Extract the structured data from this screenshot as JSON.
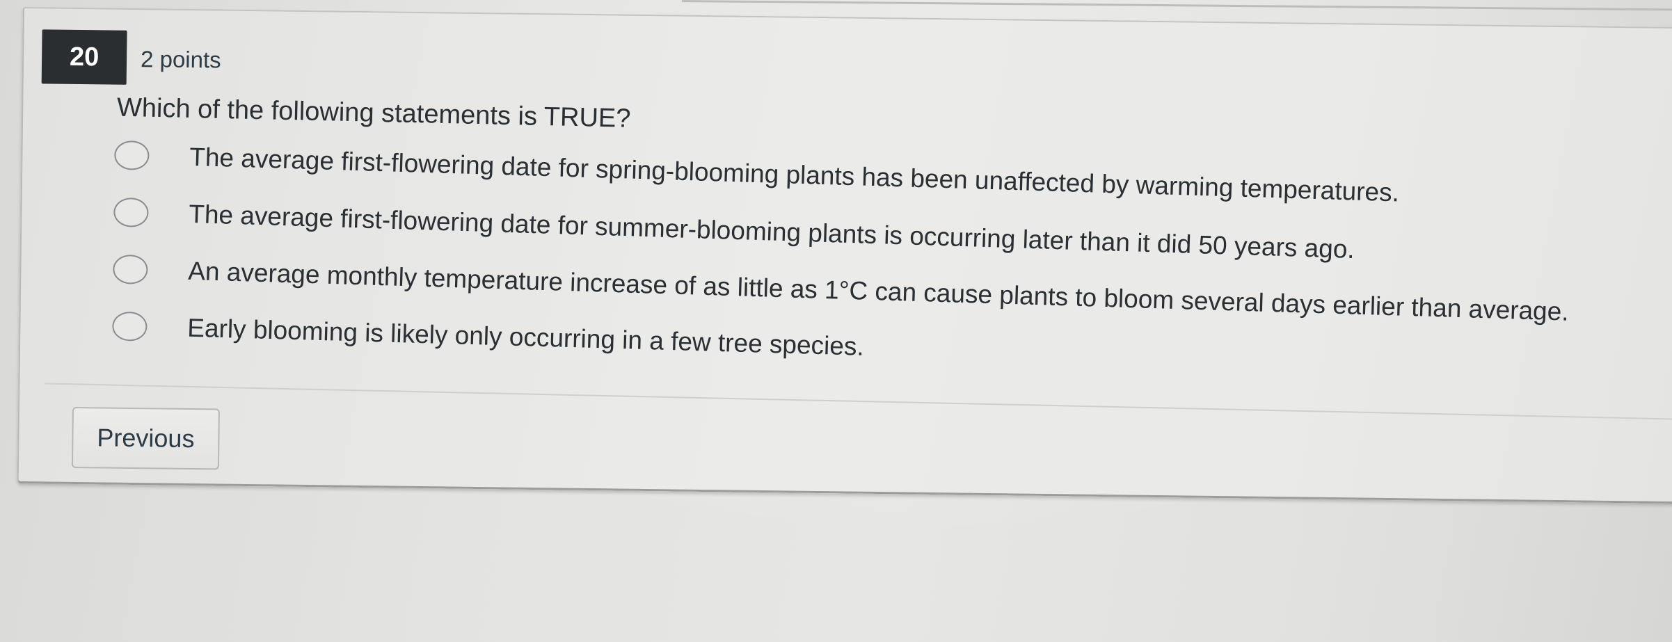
{
  "question": {
    "number": "20",
    "points": "2 points",
    "text": "Which of the following statements is TRUE?",
    "answers": [
      {
        "label": "The average first-flowering date for spring-blooming plants has been unaffected by warming temperatures."
      },
      {
        "label": "The average first-flowering date for summer-blooming plants is occurring later than it did 50 years ago."
      },
      {
        "label": "An average monthly temperature increase of as little as 1°C can cause plants to bloom several days earlier than average."
      },
      {
        "label": "Early blooming is likely only occurring in a few tree species."
      }
    ]
  },
  "navigation": {
    "previous_label": "Previous"
  },
  "colors": {
    "badge_background": "#2b2e31",
    "text": "#2d3b45"
  }
}
